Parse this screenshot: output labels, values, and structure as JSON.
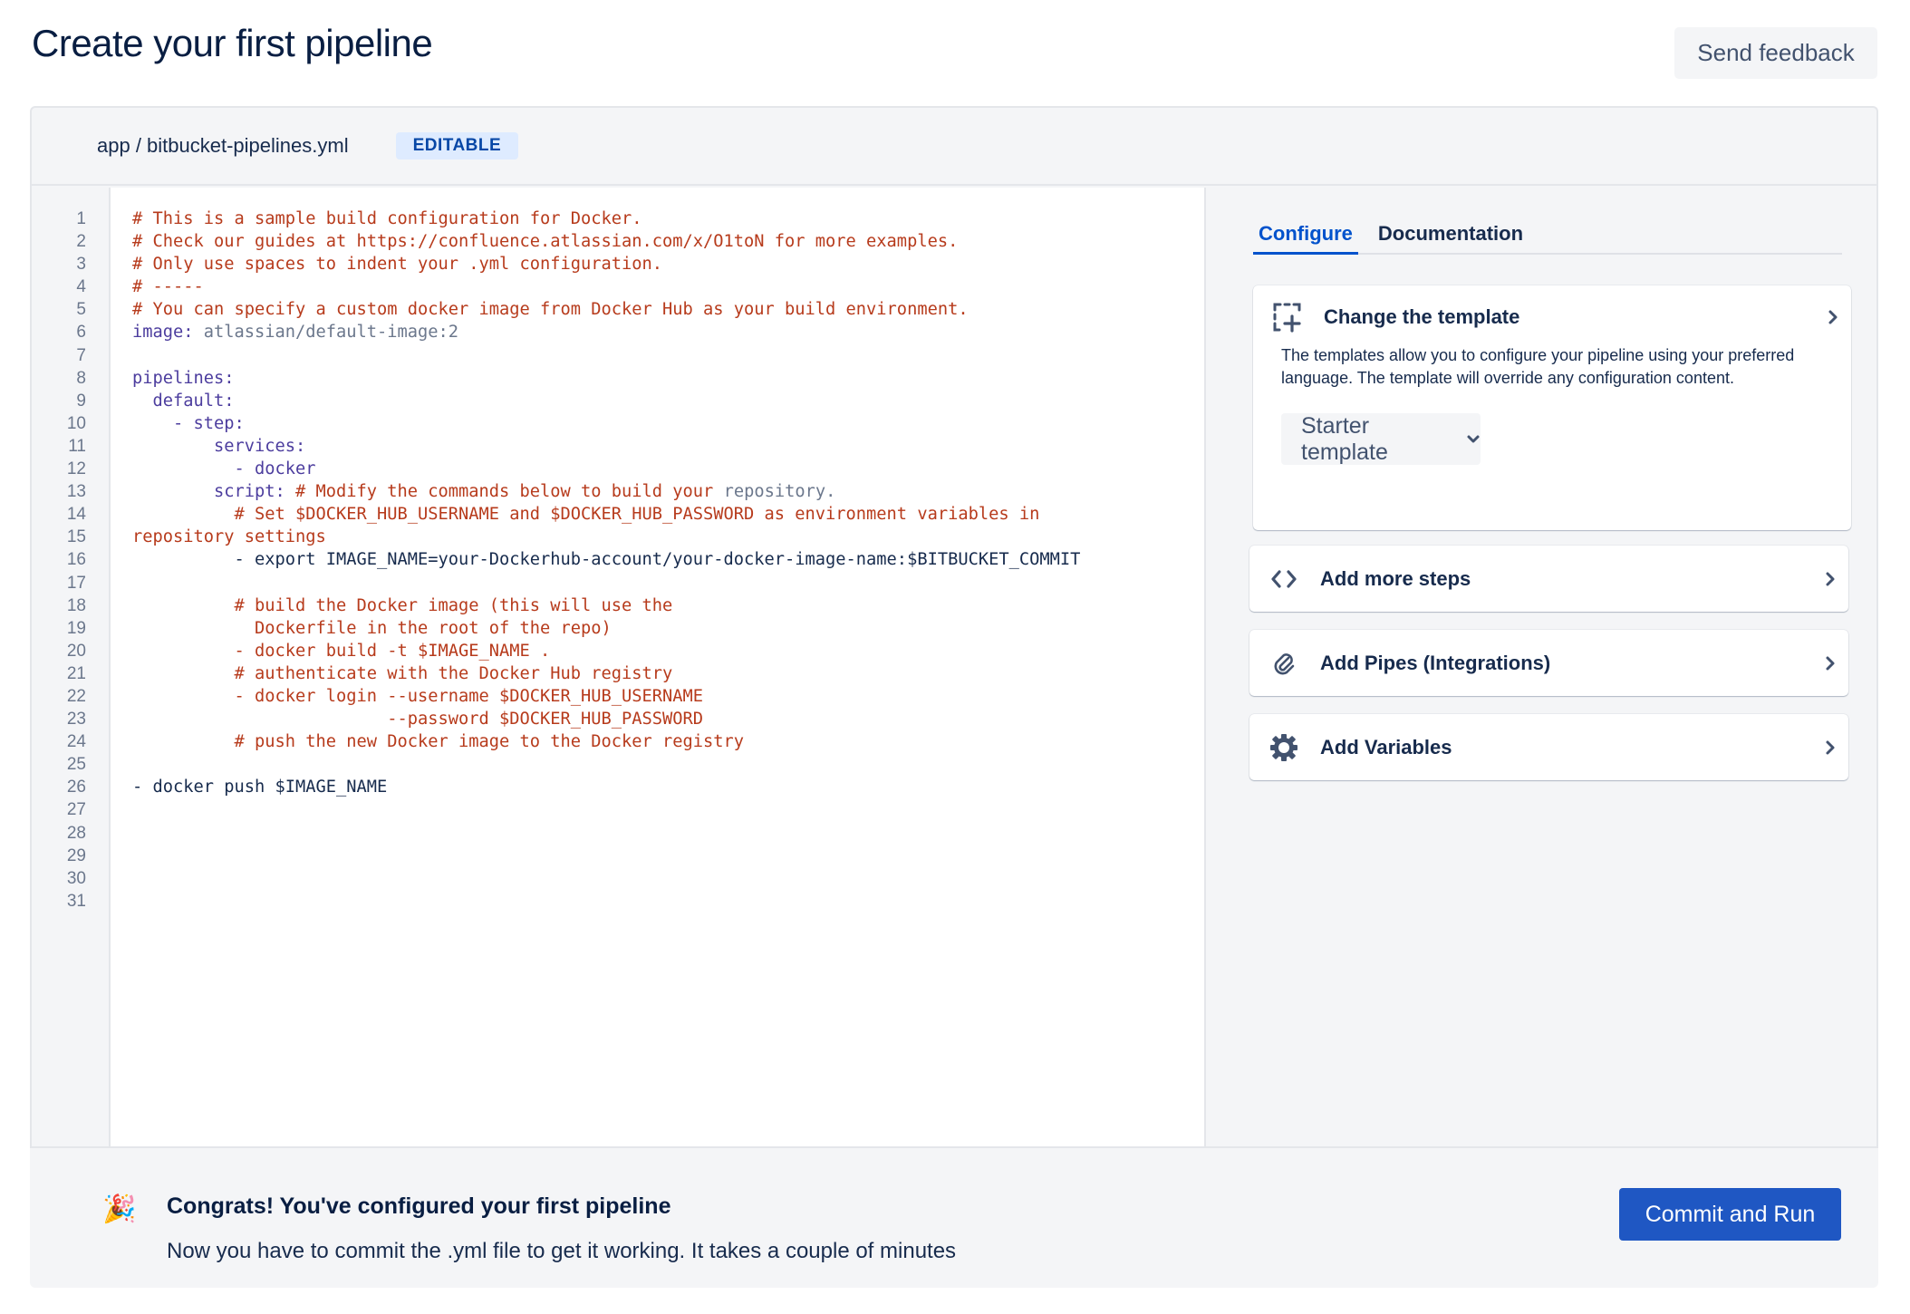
{
  "page": {
    "title": "Create your first pipeline",
    "send_feedback_label": "Send feedback"
  },
  "file": {
    "path": "app / bitbucket-pipelines.yml",
    "badge": "EDITABLE"
  },
  "editor": {
    "line_numbers": [
      "1",
      "2",
      "3",
      "4",
      "5",
      "6",
      "7",
      "8",
      "9",
      "10",
      "11",
      "12",
      "13",
      "14",
      "15",
      "16",
      "17",
      "18",
      "19",
      "20",
      "21",
      "22",
      "23",
      "24",
      "25",
      "26",
      "27",
      "28",
      "29",
      "30",
      "31"
    ],
    "lines": [
      [
        {
          "t": "comment",
          "v": "# This is a sample build configuration for Docker."
        }
      ],
      [
        {
          "t": "comment",
          "v": "# Check our guides at https://confluence.atlassian.com/x/O1toN for more examples."
        }
      ],
      [
        {
          "t": "comment",
          "v": "# Only use spaces to indent your .yml configuration."
        }
      ],
      [
        {
          "t": "comment",
          "v": "# -----"
        }
      ],
      [
        {
          "t": "comment",
          "v": "# You can specify a custom docker image from Docker Hub as your build environment."
        }
      ],
      [
        {
          "t": "key",
          "v": "image:"
        },
        {
          "t": "val",
          "v": " atlassian/default-image:2"
        }
      ],
      [],
      [
        {
          "t": "key",
          "v": "pipelines:"
        }
      ],
      [
        {
          "t": "key",
          "v": "  default:"
        }
      ],
      [
        {
          "t": "key",
          "v": "    - step:"
        }
      ],
      [
        {
          "t": "key",
          "v": "        services:"
        }
      ],
      [
        {
          "t": "key",
          "v": "          - docker"
        }
      ],
      [
        {
          "t": "key",
          "v": "        script:"
        },
        {
          "t": "comment",
          "v": " # Modify the commands below to build your"
        },
        {
          "t": "val",
          "v": " repository."
        }
      ],
      [
        {
          "t": "comment",
          "v": "          # Set $DOCKER_HUB_USERNAME and $DOCKER_HUB_PASSWORD as environment variables in"
        }
      ],
      [
        {
          "t": "comment",
          "v": "repository settings"
        }
      ],
      [
        {
          "t": "plain",
          "v": "          - export IMAGE_NAME=your-Dockerhub-account/your-docker-image-name:$BITBUCKET_COMMIT"
        }
      ],
      [],
      [
        {
          "t": "comment",
          "v": "          # build the Docker image (this will use the"
        }
      ],
      [
        {
          "t": "comment",
          "v": "            Dockerfile in the root of the repo)"
        }
      ],
      [
        {
          "t": "comment",
          "v": "          - docker build -t $IMAGE_NAME ."
        }
      ],
      [
        {
          "t": "comment",
          "v": "          # authenticate with the Docker Hub registry"
        }
      ],
      [
        {
          "t": "comment",
          "v": "          - docker login --username $DOCKER_HUB_USERNAME"
        }
      ],
      [
        {
          "t": "comment",
          "v": "                         --password $DOCKER_HUB_PASSWORD"
        }
      ],
      [
        {
          "t": "comment",
          "v": "          # push the new Docker image to the Docker registry"
        }
      ],
      [],
      [
        {
          "t": "plain",
          "v": "- docker push $IMAGE_NAME"
        }
      ],
      [],
      [],
      [],
      [],
      []
    ]
  },
  "side_panel": {
    "tabs": [
      {
        "label": "Configure",
        "active": true
      },
      {
        "label": "Documentation",
        "active": false
      }
    ],
    "template_card": {
      "title": "Change the template",
      "icon": "add-template-icon",
      "description": "The templates allow you to configure your pipeline using your preferred language. The template will override any configuration content.",
      "select_value": "Starter template"
    },
    "cards": [
      {
        "title": "Add more steps",
        "icon": "code-icon"
      },
      {
        "title": "Add Pipes (Integrations)",
        "icon": "paperclip-icon"
      },
      {
        "title": "Add Variables",
        "icon": "gear-icon"
      }
    ]
  },
  "footer": {
    "emoji": "🎉",
    "title": "Congrats! You've configured your first pipeline",
    "text": "Now you have to commit the .yml file to get it working. It takes a couple of minutes",
    "commit_label": "Commit and Run"
  },
  "colors": {
    "primary": "#1F57C3",
    "tab_active": "#0052CC",
    "badge_bg": "#DEEBFF",
    "badge_text": "#0747A6",
    "comment": "#B73B1C",
    "key": "#4C3D9E",
    "panel_bg": "#F4F5F7"
  }
}
